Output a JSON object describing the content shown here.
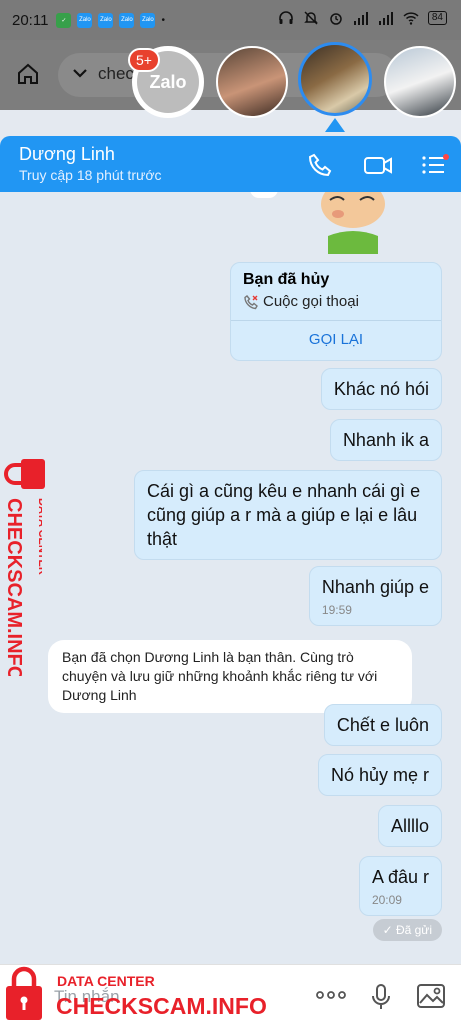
{
  "status_bar": {
    "time": "20:11",
    "app_icons": [
      "Zalo",
      "Zalo",
      "Zalo",
      "Zalo"
    ],
    "battery": "84"
  },
  "background_app": {
    "url_text": "checkscam"
  },
  "chat_heads": {
    "zalo_label": "Zalo",
    "badge": "5+"
  },
  "header": {
    "contact_name": "Dương Linh",
    "last_seen": "Truy cập 18 phút trước"
  },
  "messages": {
    "call_card": {
      "title": "Bạn đã hủy",
      "subtitle": "Cuộc gọi thoại",
      "action": "GỌI LẠI"
    },
    "m1": "Khác nó hói",
    "m2": "Nhanh ik a",
    "m3": "Cái gì a cũng kêu e nhanh cái gì e cũng giúp a r mà a giúp e lại e lâu thật",
    "m4": "Nhanh giúp e",
    "m4_time": "19:59",
    "system": "Bạn đã chọn Dương Linh là bạn thân. Cùng trò chuyện và lưu giữ những khoảnh khắc riêng tư với Dương Linh",
    "m5": "Chết e luôn",
    "m6": "Nó hủy mẹ r",
    "m7": "Allllo",
    "m8": "A đâu r",
    "m8_time": "20:09",
    "sent_status": "Đã gửi"
  },
  "watermark": {
    "small": "DATA CENTER",
    "big": "CHECKSCAM.INFO"
  },
  "input": {
    "placeholder": "Tin nhắn"
  },
  "icons": {
    "header": [
      "phone-icon",
      "video-call-icon",
      "menu-icon"
    ],
    "input": [
      "more-icon",
      "microphone-icon",
      "image-icon"
    ]
  },
  "colors": {
    "header_bg": "#2196f3",
    "bubble_bg": "#d6ecfc",
    "chat_bg": "#e2e9f1",
    "watermark_red": "#e8212a",
    "link_blue": "#1a73d9"
  }
}
